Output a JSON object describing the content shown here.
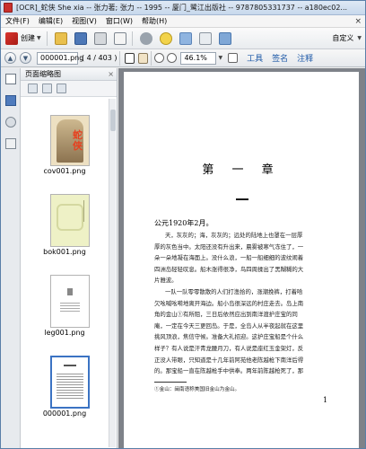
{
  "window": {
    "title": "[OCR]_蛇侠 She xia -- 张力著; 张力 -- 1995 -- 厦门_鹭江出版社 -- 9787805331737 -- a180ec02..."
  },
  "menu": {
    "items": [
      "文件(F)",
      "编辑(E)",
      "视图(V)",
      "窗口(W)",
      "帮助(H)"
    ],
    "close_glyph": "×"
  },
  "toolbar": {
    "create_label": "创建",
    "custom_label": "自定义",
    "dropdown_glyph": "▼"
  },
  "nav": {
    "prev_glyph": "▲",
    "next_glyph": "▼",
    "page_value": "000001.png",
    "page_count": "( 4 / 403 )",
    "zoom_value": "46.1%",
    "tools_label": "工具",
    "sign_label": "签名",
    "comment_label": "注释"
  },
  "panel": {
    "title": "页面缩略图",
    "close_glyph": "×",
    "thumbnails": [
      {
        "label": "cov001.png",
        "cover_text": "蛇侠"
      },
      {
        "label": "bok001.png"
      },
      {
        "label": "leg001.png"
      },
      {
        "label": "000001.png"
      }
    ]
  },
  "page": {
    "chapter_title": "第 一 章",
    "date_line": "公元1920年2月。",
    "lines": [
      "天，灰灰的；海，灰灰的；远处的陆地上也罩在一层厚",
      "厚的灰色当中。太阳还没有升出来，晨雾被寒气冻住了，一",
      "朵一朵地凝在海面上。没什么浪，一船一船细细的波纹闹着",
      "四洲岛轻轻叹息。船木涨得很净，鸟四周揉出了黑糊糊的大",
      "片雅波。",
      "一队一队零零散散的人们打渔拾的，涨潮挽裤，打着哈",
      "欠吆喊吆嗬地离开海边。船小岛很深远的村庄走去。岛上南",
      "角的金山①有所阻，三日后依然应出到南洋渡护庄宝的同",
      "庵，一定在今天三更回岛。于是，全岛人从半夜起就在这里",
      "挑风顶浪，焦信守候。准备大礼招迎。这护庄宝船是个什么",
      "样子？有人说是汗青龙腰月刀，有人说是座红玉金架灯，反",
      "正没人带眼，只知道是十几年前阿苑他老陈越枪下南洋后得",
      "的。那宝船一直在陈越枪手中供奉。两年前陈越枪死了，那"
    ],
    "footnote": "①金山：闽南语称美国旧金山为金山。",
    "page_number": "1"
  }
}
